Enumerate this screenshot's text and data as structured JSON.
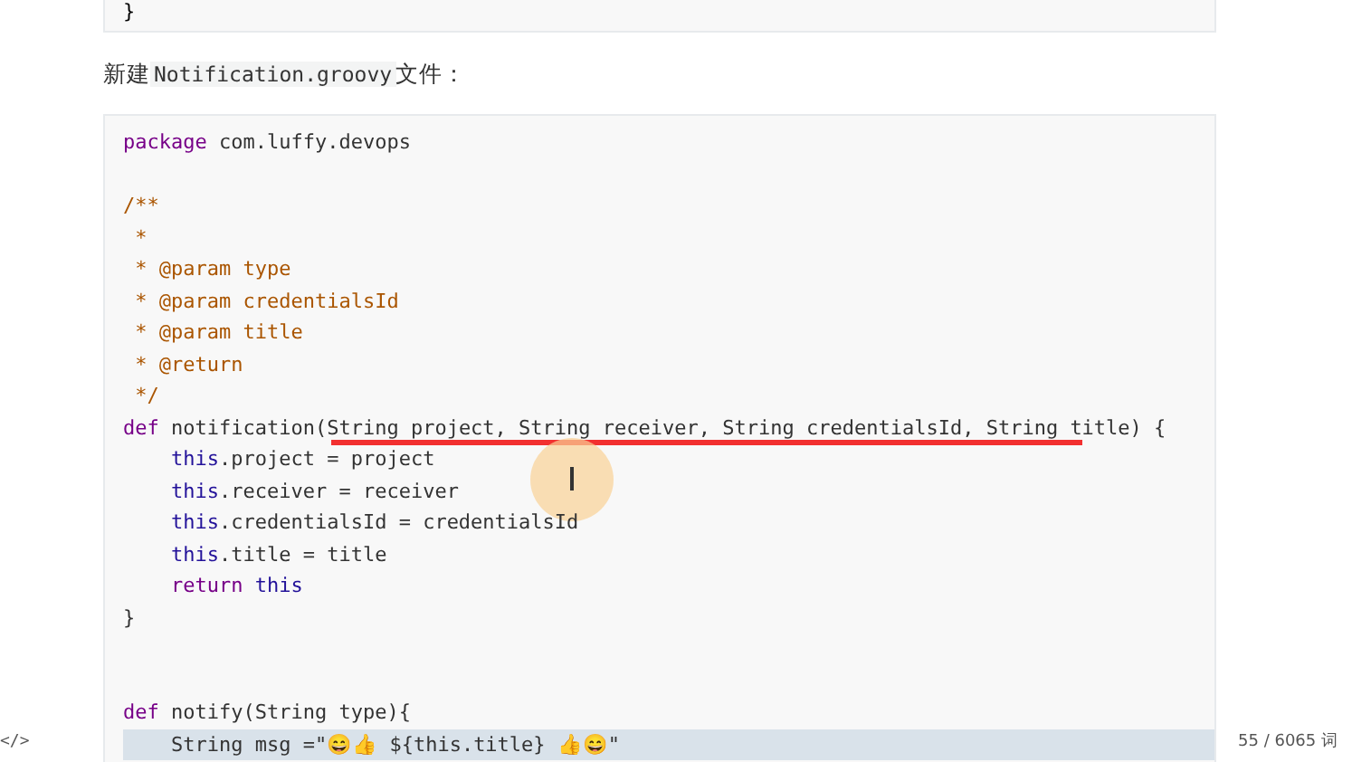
{
  "previous_code_block": {
    "lines": [
      "}"
    ]
  },
  "paragraph": {
    "before": "新建",
    "code": "Notification.groovy",
    "after": "文件："
  },
  "code_block": {
    "lines": [
      {
        "kind": "code",
        "selected": false,
        "tokens": [
          {
            "kind": "kw",
            "t": "package"
          },
          {
            "kind": "plain",
            "t": " com.luffy.devops"
          }
        ]
      },
      {
        "kind": "blank",
        "selected": false
      },
      {
        "kind": "code",
        "selected": false,
        "tokens": [
          {
            "kind": "comment",
            "t": "/**"
          }
        ]
      },
      {
        "kind": "code",
        "selected": false,
        "tokens": [
          {
            "kind": "comment",
            "t": " *"
          }
        ]
      },
      {
        "kind": "code",
        "selected": false,
        "tokens": [
          {
            "kind": "comment",
            "t": " * @param type"
          }
        ]
      },
      {
        "kind": "code",
        "selected": false,
        "tokens": [
          {
            "kind": "comment",
            "t": " * @param credentialsId"
          }
        ]
      },
      {
        "kind": "code",
        "selected": false,
        "tokens": [
          {
            "kind": "comment",
            "t": " * @param title"
          }
        ]
      },
      {
        "kind": "code",
        "selected": false,
        "tokens": [
          {
            "kind": "comment",
            "t": " * @return"
          }
        ]
      },
      {
        "kind": "code",
        "selected": false,
        "tokens": [
          {
            "kind": "comment",
            "t": " */"
          }
        ]
      },
      {
        "kind": "code",
        "selected": false,
        "underline": true,
        "tokens": [
          {
            "kind": "kw",
            "t": "def"
          },
          {
            "kind": "plain",
            "t": " notification(String project, String receiver, String credentialsId, String title) {"
          }
        ]
      },
      {
        "kind": "code",
        "selected": false,
        "tokens": [
          {
            "kind": "this",
            "t": "    this"
          },
          {
            "kind": "plain",
            "t": ".project = project"
          }
        ]
      },
      {
        "kind": "code",
        "selected": false,
        "tokens": [
          {
            "kind": "this",
            "t": "    this"
          },
          {
            "kind": "plain",
            "t": ".receiver = receiver"
          }
        ]
      },
      {
        "kind": "code",
        "selected": false,
        "tokens": [
          {
            "kind": "this",
            "t": "    this"
          },
          {
            "kind": "plain",
            "t": ".credentialsId = credentialsId"
          }
        ]
      },
      {
        "kind": "code",
        "selected": false,
        "tokens": [
          {
            "kind": "this",
            "t": "    this"
          },
          {
            "kind": "plain",
            "t": ".title = title"
          }
        ]
      },
      {
        "kind": "code",
        "selected": false,
        "tokens": [
          {
            "kind": "kw",
            "t": "    return"
          },
          {
            "kind": "this",
            "t": " this"
          }
        ]
      },
      {
        "kind": "code",
        "selected": false,
        "tokens": [
          {
            "kind": "plain",
            "t": "}"
          }
        ]
      },
      {
        "kind": "blank",
        "selected": false
      },
      {
        "kind": "blank",
        "selected": false
      },
      {
        "kind": "code",
        "selected": false,
        "tokens": [
          {
            "kind": "kw",
            "t": "def"
          },
          {
            "kind": "plain",
            "t": " notify(String type){"
          }
        ]
      },
      {
        "kind": "code",
        "selected": true,
        "tokens": [
          {
            "kind": "plain",
            "t": "    String msg =\"😄👍 ${this.title} 👍😄\""
          }
        ]
      }
    ]
  },
  "status_bar": {
    "left": "</>",
    "word_count": "55 / 6065 词"
  }
}
